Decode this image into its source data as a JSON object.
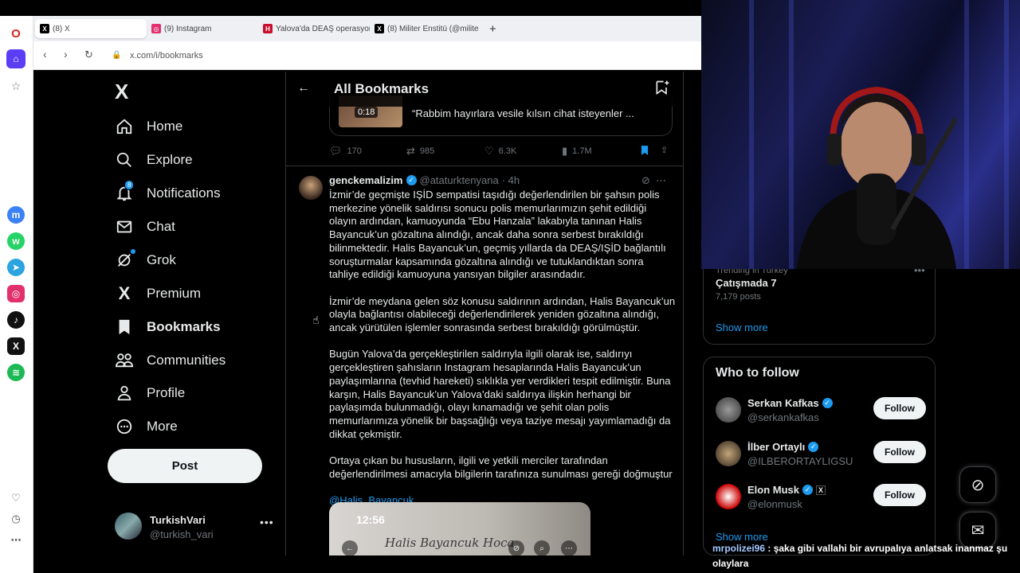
{
  "browser": {
    "tabs": [
      {
        "label": "(8) X",
        "icon": "x-icon"
      },
      {
        "label": "(9) Instagram",
        "icon": "instagram-icon"
      },
      {
        "label": "Yalova'da DEAŞ operasyon",
        "icon": "news-icon"
      },
      {
        "label": "(8) Militer Enstitü (@milite",
        "icon": "x-icon"
      }
    ],
    "url": "x.com/i/bookmarks"
  },
  "nav": {
    "logo": "X",
    "items": [
      {
        "label": "Home",
        "icon": "home-icon"
      },
      {
        "label": "Explore",
        "icon": "search-icon"
      },
      {
        "label": "Notifications",
        "icon": "bell-icon",
        "badge": "8"
      },
      {
        "label": "Chat",
        "icon": "mail-icon"
      },
      {
        "label": "Grok",
        "icon": "grok-icon"
      },
      {
        "label": "Premium",
        "icon": "x-icon"
      },
      {
        "label": "Bookmarks",
        "icon": "bookmark-icon"
      },
      {
        "label": "Communities",
        "icon": "communities-icon"
      },
      {
        "label": "Profile",
        "icon": "profile-icon"
      },
      {
        "label": "More",
        "icon": "more-circle-icon"
      }
    ],
    "post_label": "Post",
    "account": {
      "name": "TurkishVari",
      "handle": "@turkish_vari"
    }
  },
  "main": {
    "title": "All Bookmarks",
    "prev_tweet": {
      "video_duration": "0:18",
      "quote_text": "“Rabbim hayırlara vesile kılsın cihat isteyenler ...",
      "replies": "170",
      "reposts": "985",
      "likes": "6.3K",
      "views": "1.7M"
    },
    "tweet": {
      "name": "genckemalizim",
      "handle": "@ataturktenyana",
      "time": "· 4h",
      "p1": "İzmir’de geçmişte IŞİD sempatisi taşıdığı değerlendirilen bir şahsın polis merkezine yönelik saldırısı sonucu polis memurlarımızın şehit edildiği olayın ardından, kamuoyunda “Ebu Hanzala” lakabıyla tanınan Halis Bayancuk’un gözaltına alındığı, ancak daha sonra serbest bırakıldığı bilinmektedir. Halis Bayancuk’un, geçmiş yıllarda da DEAŞ/IŞİD bağlantılı soruşturmalar kapsamında gözaltına alındığı ve tutuklandıktan sonra tahliye edildiği kamuoyuna yansıyan bilgiler arasındadır.",
      "p2": "İzmir’de meydana gelen söz konusu saldırının ardından, Halis Bayancuk’un olayla bağlantısı olabileceği değerlendirilerek yeniden gözaltına alındığı, ancak yürütülen işlemler sonrasında serbest bırakıldığı görülmüştür.",
      "p3": "Bugün Yalova’da gerçekleştirilen saldırıyla ilgili olarak ise, saldırıyı gerçekleştiren şahısların Instagram hesaplarında Halis Bayancuk’un paylaşımlarına (tevhid hareketi) sıklıkla yer verdikleri tespit edilmiştir. Buna karşın, Halis Bayancuk’un Yalova’daki saldırıya ilişkin herhangi bir paylaşımda bulunmadığı, olayı kınamadığı ve şehit olan polis memurlarımıza yönelik bir başsağlığı veya taziye mesajı yayımlamadığı da dikkat çekmiştir.",
      "p4": "Ortaya çıkan bu hususların, ilgili ve yetkili merciler tarafından değerlendirilmesi amacıyla bilgilerin tarafınıza sunulması gereği doğmuştur",
      "mention": "@Halis_Bayancuk",
      "media_time": "12:56",
      "media_caption": "Halis Bayancuk Hoca"
    }
  },
  "right": {
    "trend": {
      "category": "Trending in Turkey",
      "title": "Çatışmada 7",
      "posts": "7,179 posts",
      "show_more": "Show more"
    },
    "wtf": {
      "title": "Who to follow",
      "users": [
        {
          "name": "Serkan Kafkas",
          "handle": "@serkankafkas",
          "follow": "Follow"
        },
        {
          "name": "İlber Ortaylı",
          "handle": "@ILBERORTAYLIGSU",
          "follow": "Follow"
        },
        {
          "name": "Elon Musk",
          "handle": "@elonmusk",
          "follow": "Follow"
        }
      ],
      "show_more": "Show more"
    }
  },
  "chat_overlay": {
    "user": "mrpolizei96",
    "message": " : şaka gibi vallahi bir avrupalıya anlatsak inanmaz şu olaylara"
  },
  "colors": {
    "accent": "#1d9bf0",
    "bg": "#000000",
    "text": "#e7e9ea",
    "muted": "#71767b"
  }
}
